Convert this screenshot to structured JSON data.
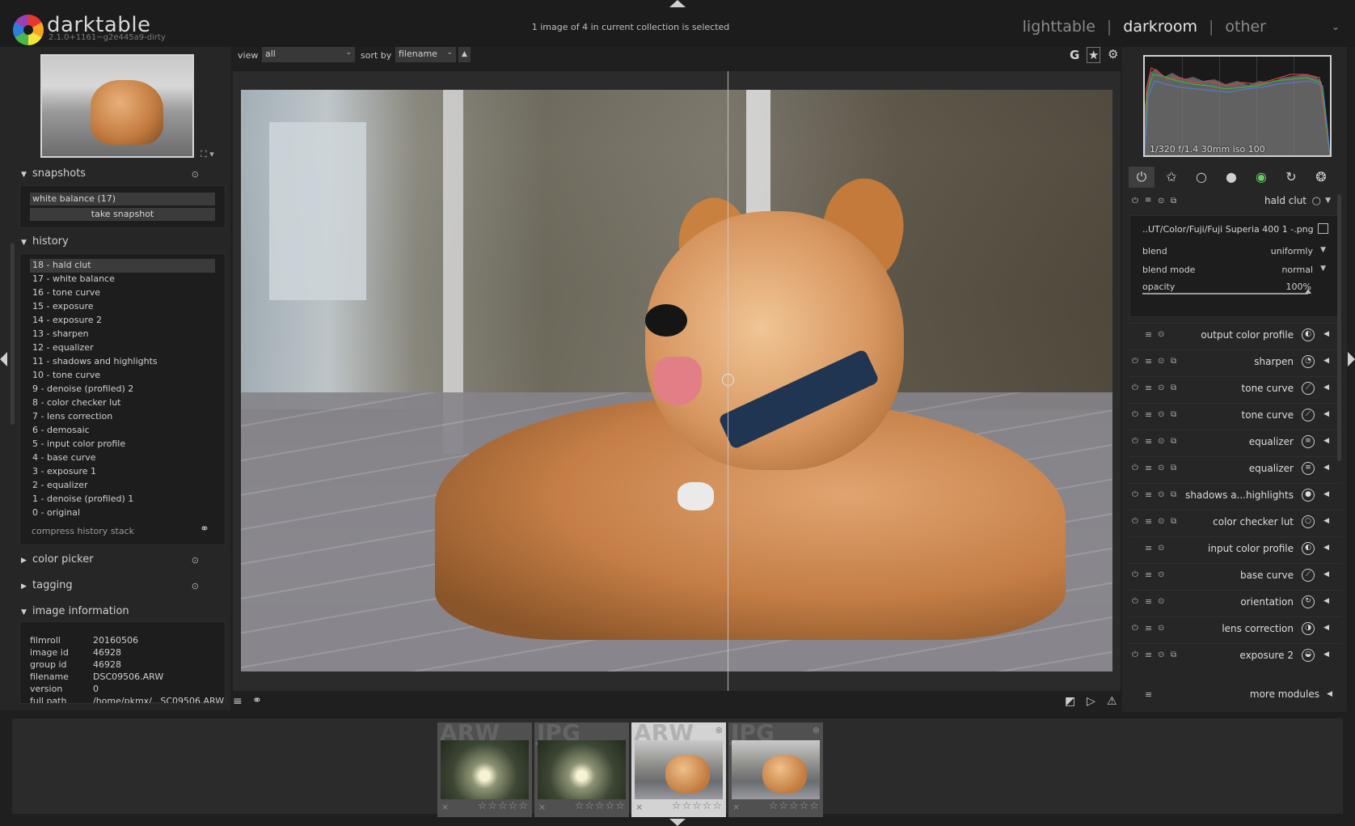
{
  "header": {
    "app_name": "darktable",
    "version": "2.1.0+1161~g2e445a9-dirty",
    "selection_status": "1 image of 4 in current collection is selected",
    "views": [
      "lighttable",
      "darkroom",
      "other"
    ],
    "active_view": "darkroom",
    "separator": "|"
  },
  "left": {
    "snapshots": {
      "title": "snapshots",
      "items": [
        "white balance (17)"
      ],
      "take_label": "take snapshot"
    },
    "history": {
      "title": "history",
      "items": [
        "18 - hald clut",
        "17 - white balance",
        "16 - tone curve",
        "15 - exposure",
        "14 - exposure 2",
        "13 - sharpen",
        "12 - equalizer",
        "11 - shadows and highlights",
        "10 - tone curve",
        "9 - denoise (profiled) 2",
        "8 - color checker lut",
        "7 - lens correction",
        "6 - demosaic",
        "5 - input color profile",
        "4 - base curve",
        "3 - exposure 1",
        "2 - equalizer",
        "1 - denoise (profiled) 1",
        "0 - original"
      ],
      "selected_index": 0,
      "compress_label": "compress history stack"
    },
    "color_picker": {
      "title": "color picker"
    },
    "tagging": {
      "title": "tagging"
    },
    "image_information": {
      "title": "image information",
      "rows": [
        {
          "k": "filmroll",
          "v": "20160506"
        },
        {
          "k": "image id",
          "v": "46928"
        },
        {
          "k": "group id",
          "v": "46928"
        },
        {
          "k": "filename",
          "v": "DSC09506.ARW"
        },
        {
          "k": "version",
          "v": "0"
        },
        {
          "k": "full path",
          "v": "/home/pkmx/...SC09506.ARW"
        }
      ]
    }
  },
  "toolbar": {
    "view_label": "view",
    "view_value": "all",
    "sort_label": "sort by",
    "sort_value": "filename",
    "sort_dir": "▲",
    "icons": [
      "G",
      "★",
      "⚙"
    ]
  },
  "filmstrip": {
    "thumbs": [
      {
        "ext": "ARW",
        "kind": "trees",
        "selected": false,
        "stars": "☆☆☆☆☆",
        "remove": "×"
      },
      {
        "ext": "JPG",
        "kind": "trees",
        "selected": false,
        "stars": "☆☆☆☆☆",
        "remove": "×"
      },
      {
        "ext": "ARW",
        "kind": "dog",
        "selected": true,
        "stars": "☆☆☆☆☆",
        "remove": "×"
      },
      {
        "ext": "JPG",
        "kind": "dog",
        "selected": false,
        "stars": "☆☆☆☆☆",
        "remove": "×"
      }
    ]
  },
  "right": {
    "exif": "1/320 f/1.4 30mm iso 100",
    "hald_clut": {
      "title": "hald clut",
      "lut_path": "..UT/Color/Fuji/Fuji Superia 400 1 -.png",
      "blend_label": "blend",
      "blend_value": "uniformly",
      "blend_mode_label": "blend mode",
      "blend_mode_value": "normal",
      "opacity_label": "opacity",
      "opacity_value": "100%",
      "opacity_fraction": 1.0
    },
    "modules": [
      {
        "name": "output color profile",
        "icon": "◐",
        "on": false
      },
      {
        "name": "sharpen",
        "icon": "◔",
        "on": true
      },
      {
        "name": "tone curve",
        "icon": "⟋",
        "on": true
      },
      {
        "name": "tone curve",
        "icon": "⟋",
        "on": true
      },
      {
        "name": "equalizer",
        "icon": "≡",
        "on": true
      },
      {
        "name": "equalizer",
        "icon": "≡",
        "on": true
      },
      {
        "name": "shadows a...highlights",
        "icon": "●",
        "on": true
      },
      {
        "name": "color checker lut",
        "icon": "○",
        "on": true
      },
      {
        "name": "input color profile",
        "icon": "◐",
        "on": false
      },
      {
        "name": "base curve",
        "icon": "⟋",
        "on": true
      },
      {
        "name": "orientation",
        "icon": "↻",
        "on": true
      },
      {
        "name": "lens correction",
        "icon": "◑",
        "on": true
      },
      {
        "name": "exposure 2",
        "icon": "◒",
        "on": true
      }
    ],
    "more_modules_label": "more modules"
  }
}
